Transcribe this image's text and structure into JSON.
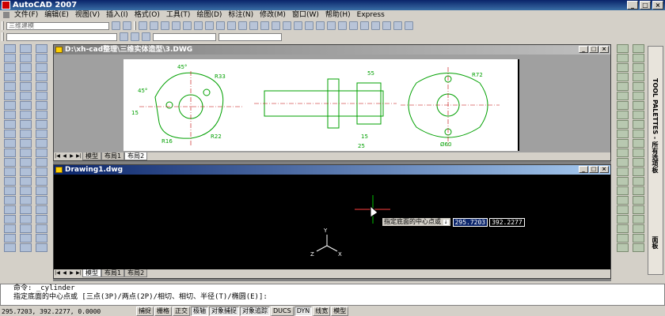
{
  "app": {
    "title": "AutoCAD 2007"
  },
  "menu": [
    "文件(F)",
    "编辑(E)",
    "视图(V)",
    "插入(I)",
    "格式(O)",
    "工具(T)",
    "绘图(D)",
    "标注(N)",
    "修改(M)",
    "窗口(W)",
    "帮助(H)",
    "Express"
  ],
  "toolbar": {
    "workspace": "三维建模"
  },
  "windows": {
    "drawing_3": {
      "title": "D:\\xh-cad整理\\三维实体造型\\3.DWG",
      "tabs": [
        "模型",
        "布局1",
        "布局2"
      ]
    },
    "drawing_1": {
      "title": "Drawing1.dwg",
      "tabs": [
        "模型",
        "布局1",
        "布局2"
      ]
    }
  },
  "dims": {
    "d45a": "45°",
    "d45b": "45°",
    "r33": "R33",
    "r72": "R72",
    "r16": "R16",
    "r22": "R22",
    "c15": "15",
    "d60": "Ø60",
    "d25": "25",
    "d15": "15",
    "d55": "55"
  },
  "dynamic_input": {
    "prompt": "指定底面的中心点或",
    "x": "295.7203",
    "y": "392.2277"
  },
  "ucs": {
    "x": "X",
    "y": "Y",
    "z": "Z"
  },
  "command": {
    "line1": "命令: _cylinder",
    "line2": "指定底面的中心点或 [三点(3P)/两点(2P)/相切、相切、半径(T)/椭圆(E)]:"
  },
  "status": {
    "coords": "295.7203,   392.2277, 0.0000",
    "buttons": [
      "捕捉",
      "栅格",
      "正交",
      "极轴",
      "对象捕捉",
      "对象追踪",
      "DUCS",
      "DYN",
      "线宽",
      "模型"
    ]
  },
  "palette": {
    "label": "TOOL PALETTES - 所有选项板",
    "label2": "面板"
  }
}
